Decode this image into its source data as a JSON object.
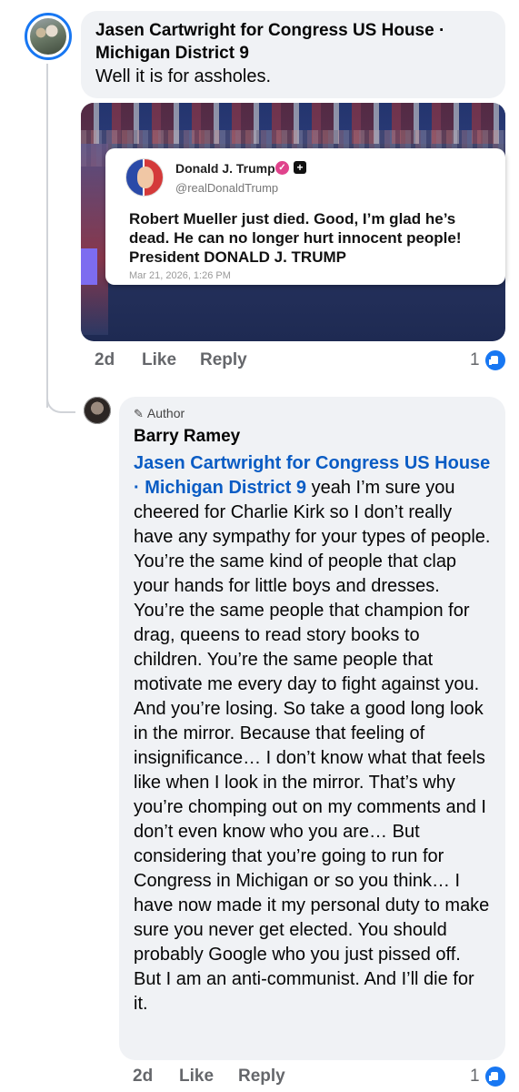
{
  "comment": {
    "author": "Jasen Cartwright for Congress US House · Michigan District 9",
    "text": "Well it is for assholes.",
    "image": {
      "tweet": {
        "name": "Donald J. Trump",
        "handle": "@realDonaldTrump",
        "text": "Robert Mueller just died. Good, I’m glad he’s dead. He can no longer hurt innocent people! President DONALD J. TRUMP",
        "date": "Mar 21, 2026, 1:26 PM"
      }
    },
    "time": "2d",
    "like_label": "Like",
    "reply_label": "Reply",
    "reaction_count": "1"
  },
  "reply": {
    "badge": "Author",
    "author": "Barry Ramey",
    "mention": "Jasen Cartwright for Congress US House · Michigan District 9",
    "text": " yeah I’m sure you cheered for Charlie Kirk so I don’t really have any sympathy for your types of people. You’re the same kind of people that clap your hands for little boys and dresses. You’re the same people that champion for drag, queens to read story books to children. You’re the same people that motivate me every day to fight against you. And you’re losing. So take a good long look in the mirror. Because that feeling of insignificance… I don’t know what that feels like when I look in the mirror. That’s why you’re chomping out on my comments and I don’t even know who you are… But considering that you’re going to run for Congress in Michigan or so you think… I have now made it my personal duty to make sure you never get elected. You should probably Google who you just pissed off. But I am an anti-communist. And I’ll die for it.",
    "time": "2d",
    "like_label": "Like",
    "reply_label": "Reply",
    "reaction_count": "1"
  },
  "colors": {
    "accent": "#1877f2",
    "mention": "#0a5cc4",
    "bubble": "#f0f2f5",
    "meta": "#65676b"
  }
}
